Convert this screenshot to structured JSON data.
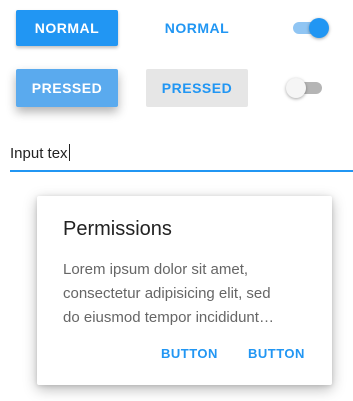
{
  "buttons": {
    "raised_normal": "NORMAL",
    "flat_normal": "NORMAL",
    "raised_pressed": "PRESSED",
    "flat_pressed": "PRESSED"
  },
  "switches": {
    "top": "on",
    "bottom": "off"
  },
  "input": {
    "value": "Input tex"
  },
  "card": {
    "title": "Permissions",
    "body_lines": [
      "Lorem ipsum dolor sit amet,",
      "consectetur adipisicing elit, sed",
      "do eiusmod tempor incididunt…"
    ],
    "actions": [
      "BUTTON",
      "BUTTON"
    ]
  },
  "colors": {
    "accent": "#2196f3",
    "pressed_raised": "#5aaaee",
    "pressed_flat_bg": "#e6e6e6"
  }
}
